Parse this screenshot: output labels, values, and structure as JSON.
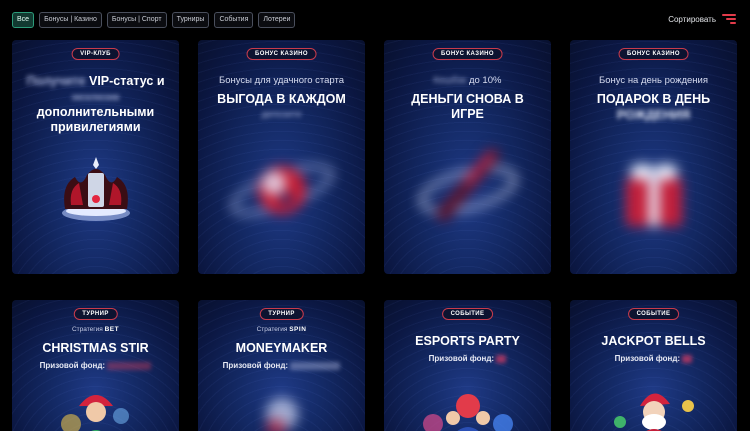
{
  "filters": [
    "Все",
    "Бонусы | Казино",
    "Бонусы | Спорт",
    "Турниры",
    "События",
    "Лотереи"
  ],
  "sort": {
    "label": "Сортировать",
    "icon": "sort-icon",
    "accent": "#e23b4a"
  },
  "cards": [
    {
      "badge": "VIP-КЛУБ",
      "subtitle_blur": "Получите",
      "title_pre": "VIP-статус и",
      "title_blur": "эксклюзив",
      "title_rest": "дополнительными привилегиями",
      "art": "crown-icon"
    },
    {
      "badge": "БОНУС КАЗИНО",
      "subtitle": "Бонусы для удачного старта",
      "title": "ВЫГОДА В КАЖДОМ",
      "title_blur": "депозите",
      "art": "planet-icon"
    },
    {
      "badge": "БОНУС КАЗИНО",
      "subtitle_blur": "Кешбэк",
      "subtitle": "до 10%",
      "title": "ДЕНЬГИ СНОВА В ИГРЕ",
      "art": "rocket-icon"
    },
    {
      "badge": "БОНУС КАЗИНО",
      "subtitle": "Бонус на день рождения",
      "title": "ПОДАРОК В ДЕНЬ",
      "title_blur": "РОЖДЕНИЯ",
      "art": "gift-icon"
    },
    {
      "badge": "ТУРНИР",
      "strategy_pre": "Стратегия",
      "strategy": "BET",
      "title": "CHRISTMAS STIR",
      "prize_label": "Призовой фонд:",
      "art": "santa-girl-icon"
    },
    {
      "badge": "ТУРНИР",
      "strategy_pre": "Стратегия",
      "strategy": "SPIN",
      "title": "MONEYMAKER",
      "prize_label": "Призовой фонд:",
      "art": "money-icon"
    },
    {
      "badge": "СОБЫТИЕ",
      "title": "ESPORTS PARTY",
      "prize_label": "Призовой фонд:",
      "art": "esports-icon"
    },
    {
      "badge": "СОБЫТИЕ",
      "title": "JACKPOT BELLS",
      "prize_label": "Призовой фонд:",
      "art": "santa-icon"
    }
  ]
}
